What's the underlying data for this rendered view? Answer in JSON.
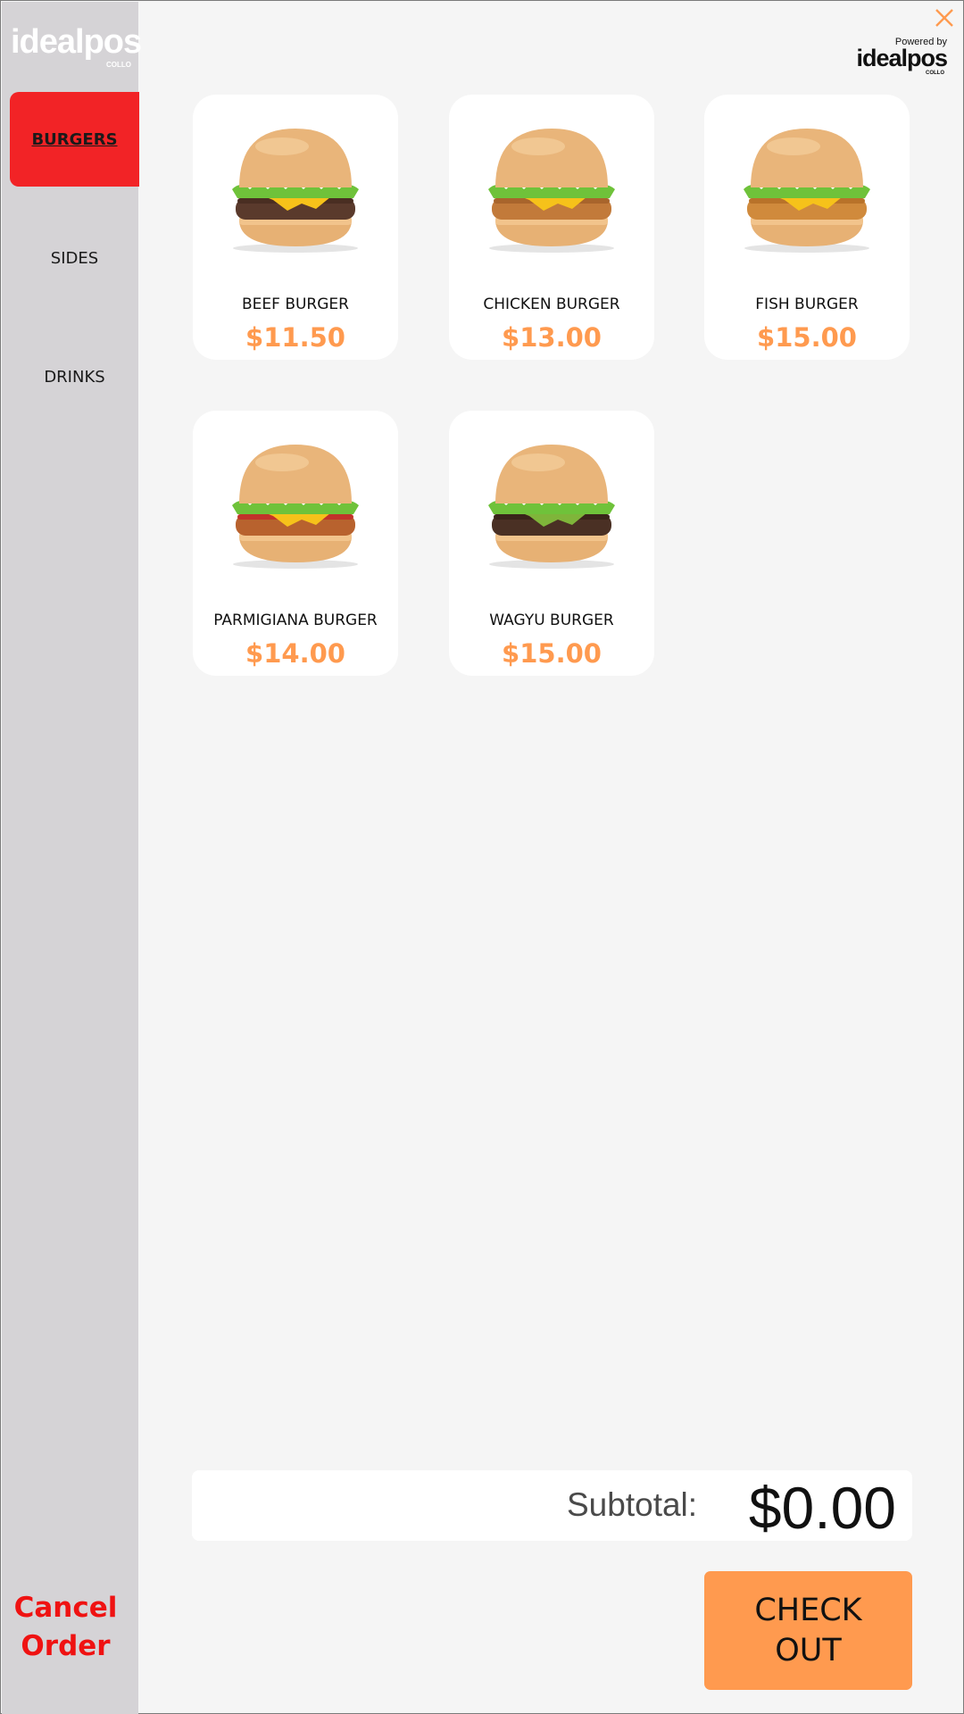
{
  "sidebar": {
    "brand": "idealpos",
    "brand_sub": "COLLO",
    "items": [
      {
        "label": "BURGERS",
        "active": true
      },
      {
        "label": "SIDES",
        "active": false
      },
      {
        "label": "DRINKS",
        "active": false
      }
    ],
    "cancel_line1": "Cancel",
    "cancel_line2": "Order"
  },
  "header": {
    "powered_by": "Powered by",
    "logo": "idealpos",
    "logo_sub": "COLLO",
    "close_icon": "close-icon"
  },
  "products": [
    {
      "name": "BEEF BURGER",
      "price": "$11.50",
      "patty": "beef"
    },
    {
      "name": "CHICKEN BURGER",
      "price": "$13.00",
      "patty": "chicken"
    },
    {
      "name": "FISH BURGER",
      "price": "$15.00",
      "patty": "fish"
    },
    {
      "name": "PARMIGIANA BURGER",
      "price": "$14.00",
      "patty": "parmigiana"
    },
    {
      "name": "WAGYU BURGER",
      "price": "$15.00",
      "patty": "wagyu"
    }
  ],
  "order": {
    "subtotal_label": "Subtotal:",
    "subtotal_value": "$0.00",
    "checkout_line1": "CHECK",
    "checkout_line2": "OUT"
  },
  "colors": {
    "active_nav": "#f22326",
    "accent": "#ff9a4f",
    "cancel": "#ef1212",
    "sidebar": "#d5d3d6"
  }
}
